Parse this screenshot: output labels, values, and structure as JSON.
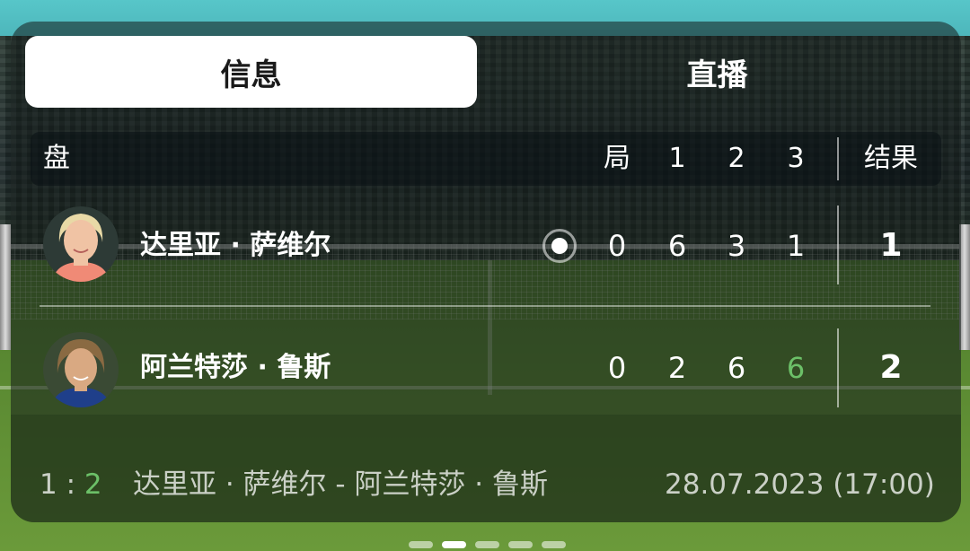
{
  "tabs": [
    {
      "label": "信息",
      "active": true
    },
    {
      "label": "直播",
      "active": false
    }
  ],
  "header": {
    "set_label": "盘",
    "games_label": "局",
    "set1": "1",
    "set2": "2",
    "set3": "3",
    "result_label": "结果"
  },
  "players": [
    {
      "name": "达里亚 · 萨维尔",
      "serving": true,
      "games": "0",
      "set1": "6",
      "set2": "3",
      "set3": "1",
      "result": "1"
    },
    {
      "name": "阿兰特莎 · 鲁斯",
      "serving": false,
      "games": "0",
      "set1": "2",
      "set2": "6",
      "set3": "6",
      "result": "2"
    }
  ],
  "footer": {
    "score_home": "1",
    "score_sep": ":",
    "score_away": "2",
    "match": "达里亚 · 萨维尔 - 阿兰特莎 · 鲁斯",
    "datetime": "28.07.2023 (17:00)"
  },
  "pager": {
    "count": 5,
    "active_index": 1
  },
  "colors": {
    "win_green": "#6cc068",
    "tab_active_bg": "#ffffff",
    "text_primary": "#ffffff"
  },
  "icons": {
    "serve_indicator": "serve-indicator-icon",
    "player1_avatar": "player-avatar",
    "player2_avatar": "player-avatar"
  }
}
